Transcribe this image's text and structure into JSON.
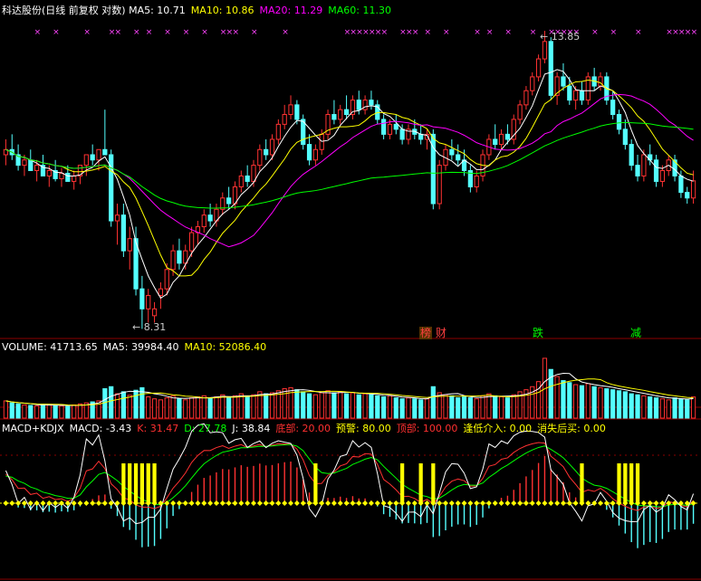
{
  "header": {
    "title": "科达股份(日线 前复权 对数)",
    "ma": [
      {
        "label": "MA5: 10.71",
        "color": "#ffffff"
      },
      {
        "label": "MA10: 10.86",
        "color": "#ffff00"
      },
      {
        "label": "MA20: 11.29",
        "color": "#ff00ff"
      },
      {
        "label": "MA60: 11.30",
        "color": "#00ff00"
      }
    ]
  },
  "price_panel": {
    "high_label": "13.85",
    "low_label": "8.31",
    "markers": [
      {
        "text": "榜",
        "color": "#ff4040"
      },
      {
        "text": "财",
        "color": "#ff4040"
      },
      {
        "text": "跌",
        "color": "#00ff00"
      },
      {
        "text": "减",
        "color": "#00ff00"
      }
    ]
  },
  "volume_panel": {
    "items": [
      {
        "label": "VOLUME: 41713.65",
        "color": "#ffffff"
      },
      {
        "label": "MA5: 39984.40",
        "color": "#ffffff"
      },
      {
        "label": "MA10: 52086.40",
        "color": "#ffff00"
      }
    ]
  },
  "macd_panel": {
    "items": [
      {
        "label": "MACD+KDJX",
        "color": "#ffffff"
      },
      {
        "label": "MACD: -3.43",
        "color": "#ffffff"
      },
      {
        "label": "K: 31.47",
        "color": "#ff3030"
      },
      {
        "label": "D: 27.78",
        "color": "#00ff00"
      },
      {
        "label": "J: 38.84",
        "color": "#ffffff"
      },
      {
        "label": "底部: 20.00",
        "color": "#ff3030"
      },
      {
        "label": "预警: 80.00",
        "color": "#ffff00"
      },
      {
        "label": "顶部: 100.00",
        "color": "#ff3030"
      },
      {
        "label": "逢低介入: 0.00",
        "color": "#ffff00"
      },
      {
        "label": "消失后买: 0.00",
        "color": "#ffff00"
      }
    ]
  },
  "colors": {
    "up": "#ff3232",
    "down": "#54ffff",
    "ma5": "#ffffff",
    "ma10": "#ffff00",
    "ma20": "#ff00ff",
    "ma60": "#00ff00",
    "grid": "#8b0000"
  },
  "chart_data": {
    "type": "candlestick",
    "ohlc": [
      [
        11.2,
        11.5,
        11.0,
        11.3
      ],
      [
        11.3,
        11.6,
        11.1,
        11.2
      ],
      [
        11.2,
        11.4,
        10.9,
        11.0
      ],
      [
        11.0,
        11.2,
        10.8,
        11.1
      ],
      [
        11.1,
        11.3,
        10.9,
        10.9
      ],
      [
        10.9,
        11.1,
        10.7,
        11.0
      ],
      [
        11.0,
        11.2,
        10.8,
        10.8
      ],
      [
        10.8,
        11.0,
        10.6,
        10.9
      ],
      [
        10.9,
        11.1,
        10.7,
        10.75
      ],
      [
        10.75,
        10.95,
        10.6,
        10.85
      ],
      [
        10.85,
        11.0,
        10.7,
        10.7
      ],
      [
        10.7,
        10.9,
        10.55,
        10.8
      ],
      [
        10.8,
        11.0,
        10.65,
        11.0
      ],
      [
        11.0,
        11.2,
        10.8,
        11.2
      ],
      [
        11.2,
        11.4,
        11.0,
        11.1
      ],
      [
        11.1,
        11.3,
        10.9,
        11.3
      ],
      [
        11.3,
        12.1,
        11.2,
        11.2
      ],
      [
        11.2,
        11.3,
        9.9,
        10.0
      ],
      [
        10.0,
        10.3,
        9.6,
        10.1
      ],
      [
        10.1,
        10.3,
        9.4,
        9.5
      ],
      [
        9.5,
        9.9,
        9.2,
        9.7
      ],
      [
        9.7,
        9.9,
        8.8,
        8.9
      ],
      [
        8.9,
        9.1,
        8.31,
        8.6
      ],
      [
        8.6,
        8.9,
        8.4,
        8.8
      ],
      [
        8.5,
        8.7,
        8.4,
        8.6
      ],
      [
        8.8,
        9.0,
        8.6,
        8.9
      ],
      [
        8.9,
        9.3,
        8.8,
        9.2
      ],
      [
        9.2,
        9.6,
        9.1,
        9.5
      ],
      [
        9.5,
        9.7,
        9.2,
        9.3
      ],
      [
        9.3,
        9.6,
        9.2,
        9.5
      ],
      [
        9.5,
        9.9,
        9.4,
        9.8
      ],
      [
        9.8,
        10.0,
        9.6,
        9.9
      ],
      [
        9.9,
        10.2,
        9.8,
        10.1
      ],
      [
        10.1,
        10.3,
        9.9,
        10.0
      ],
      [
        10.0,
        10.3,
        9.9,
        10.2
      ],
      [
        10.2,
        10.5,
        10.1,
        10.4
      ],
      [
        10.4,
        10.6,
        10.2,
        10.3
      ],
      [
        10.3,
        10.7,
        10.2,
        10.6
      ],
      [
        10.6,
        10.9,
        10.5,
        10.8
      ],
      [
        10.8,
        11.0,
        10.6,
        10.7
      ],
      [
        10.7,
        11.1,
        10.6,
        11.0
      ],
      [
        11.0,
        11.4,
        10.9,
        11.3
      ],
      [
        11.3,
        11.5,
        11.1,
        11.2
      ],
      [
        11.2,
        11.6,
        11.1,
        11.5
      ],
      [
        11.5,
        11.9,
        11.4,
        11.8
      ],
      [
        11.8,
        12.2,
        11.7,
        12.0
      ],
      [
        12.0,
        12.4,
        11.9,
        12.2
      ],
      [
        12.2,
        12.3,
        11.8,
        11.9
      ],
      [
        11.9,
        12.0,
        11.3,
        11.4
      ],
      [
        11.4,
        11.6,
        11.0,
        11.1
      ],
      [
        11.1,
        11.4,
        11.0,
        11.3
      ],
      [
        11.3,
        11.7,
        11.2,
        11.6
      ],
      [
        11.6,
        12.1,
        11.5,
        12.0
      ],
      [
        12.0,
        12.3,
        11.8,
        11.9
      ],
      [
        11.9,
        12.2,
        11.8,
        12.1
      ],
      [
        12.1,
        12.4,
        11.9,
        12.0
      ],
      [
        12.0,
        12.4,
        11.9,
        12.3
      ],
      [
        12.3,
        12.5,
        12.0,
        12.1
      ],
      [
        12.1,
        12.4,
        12.0,
        12.3
      ],
      [
        12.3,
        12.5,
        12.1,
        12.2
      ],
      [
        12.2,
        12.3,
        11.8,
        11.9
      ],
      [
        11.9,
        12.0,
        11.5,
        11.6
      ],
      [
        11.6,
        11.9,
        11.5,
        11.8
      ],
      [
        11.8,
        12.0,
        11.6,
        11.7
      ],
      [
        11.7,
        11.8,
        11.4,
        11.5
      ],
      [
        11.5,
        11.8,
        11.4,
        11.7
      ],
      [
        11.7,
        11.9,
        11.5,
        11.6
      ],
      [
        11.6,
        11.8,
        11.4,
        11.5
      ],
      [
        11.5,
        11.7,
        11.3,
        11.6
      ],
      [
        11.6,
        11.7,
        10.2,
        10.3
      ],
      [
        10.3,
        11.1,
        10.2,
        11.0
      ],
      [
        11.0,
        11.4,
        10.9,
        11.3
      ],
      [
        11.3,
        11.5,
        11.1,
        11.2
      ],
      [
        11.2,
        11.4,
        11.0,
        11.1
      ],
      [
        11.1,
        11.3,
        10.8,
        10.9
      ],
      [
        10.9,
        11.0,
        10.5,
        10.6
      ],
      [
        10.6,
        10.9,
        10.5,
        10.8
      ],
      [
        10.8,
        11.3,
        10.7,
        11.2
      ],
      [
        11.2,
        11.6,
        11.1,
        11.5
      ],
      [
        11.5,
        11.8,
        11.3,
        11.4
      ],
      [
        11.4,
        11.7,
        11.3,
        11.6
      ],
      [
        11.6,
        11.8,
        11.4,
        11.5
      ],
      [
        11.5,
        12.0,
        11.4,
        11.9
      ],
      [
        11.9,
        12.3,
        11.8,
        12.2
      ],
      [
        12.2,
        12.6,
        12.1,
        12.5
      ],
      [
        12.5,
        12.9,
        12.4,
        12.8
      ],
      [
        12.8,
        13.3,
        12.7,
        13.2
      ],
      [
        13.2,
        13.85,
        13.1,
        13.6
      ],
      [
        13.6,
        13.7,
        12.3,
        12.4
      ],
      [
        12.4,
        12.9,
        12.2,
        12.8
      ],
      [
        12.8,
        13.1,
        12.5,
        12.6
      ],
      [
        12.6,
        12.8,
        12.2,
        12.3
      ],
      [
        12.3,
        12.6,
        12.1,
        12.5
      ],
      [
        12.5,
        12.7,
        12.2,
        12.3
      ],
      [
        12.3,
        12.9,
        12.2,
        12.8
      ],
      [
        12.8,
        13.0,
        12.5,
        12.6
      ],
      [
        12.6,
        12.9,
        12.5,
        12.8
      ],
      [
        12.8,
        12.9,
        12.2,
        12.3
      ],
      [
        12.3,
        12.5,
        11.9,
        12.0
      ],
      [
        12.0,
        12.1,
        11.6,
        11.7
      ],
      [
        11.7,
        11.9,
        11.3,
        11.4
      ],
      [
        11.4,
        11.5,
        10.9,
        11.0
      ],
      [
        11.0,
        11.2,
        10.7,
        10.8
      ],
      [
        10.8,
        11.3,
        10.7,
        11.2
      ],
      [
        11.2,
        11.4,
        11.0,
        11.1
      ],
      [
        11.1,
        11.2,
        10.6,
        10.7
      ],
      [
        10.7,
        11.0,
        10.6,
        10.9
      ],
      [
        10.9,
        11.2,
        10.8,
        11.1
      ],
      [
        11.1,
        11.2,
        10.7,
        10.8
      ],
      [
        10.8,
        10.9,
        10.4,
        10.5
      ],
      [
        10.5,
        10.6,
        10.3,
        10.4
      ],
      [
        10.4,
        10.9,
        10.3,
        10.71
      ]
    ],
    "volume": [
      34,
      30,
      28,
      26,
      25,
      24,
      26,
      27,
      25,
      24,
      23,
      26,
      28,
      30,
      32,
      34,
      58,
      62,
      48,
      52,
      45,
      55,
      60,
      42,
      38,
      36,
      40,
      44,
      38,
      36,
      40,
      42,
      44,
      40,
      42,
      46,
      40,
      44,
      48,
      42,
      46,
      52,
      48,
      50,
      54,
      58,
      60,
      56,
      52,
      48,
      46,
      50,
      54,
      50,
      52,
      48,
      50,
      46,
      48,
      46,
      44,
      42,
      44,
      40,
      38,
      40,
      38,
      36,
      38,
      62,
      50,
      46,
      44,
      40,
      42,
      40,
      38,
      44,
      48,
      44,
      42,
      40,
      46,
      52,
      56,
      62,
      72,
      118,
      96,
      82,
      74,
      70,
      66,
      64,
      68,
      62,
      60,
      58,
      56,
      54,
      52,
      48,
      46,
      44,
      42,
      40,
      38,
      36,
      40,
      38,
      36,
      41.7
    ],
    "volume_label": "VOLUME",
    "volume_ylim": [
      0,
      125
    ],
    "ylim": [
      8.2,
      14.2
    ],
    "log_scale": true,
    "high": 13.85,
    "low": 8.31
  }
}
